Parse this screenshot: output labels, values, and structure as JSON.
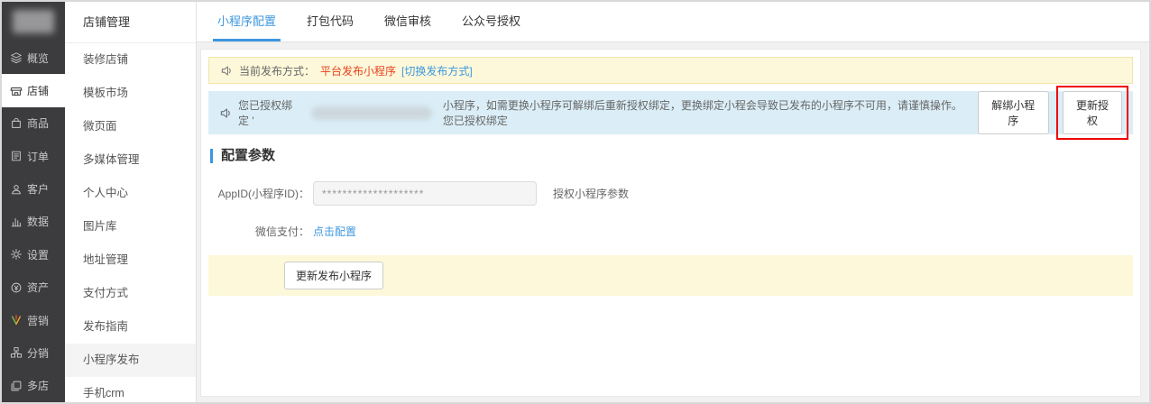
{
  "primary_nav": [
    {
      "label": "概览",
      "icon": "overview-icon"
    },
    {
      "label": "店铺",
      "icon": "store-icon"
    },
    {
      "label": "商品",
      "icon": "goods-icon"
    },
    {
      "label": "订单",
      "icon": "orders-icon"
    },
    {
      "label": "客户",
      "icon": "customers-icon"
    },
    {
      "label": "数据",
      "icon": "data-icon"
    },
    {
      "label": "设置",
      "icon": "settings-icon"
    },
    {
      "label": "资产",
      "icon": "assets-icon"
    },
    {
      "label": "营销",
      "icon": "marketing-icon"
    },
    {
      "label": "分销",
      "icon": "distribution-icon"
    },
    {
      "label": "多店",
      "icon": "multistore-icon"
    }
  ],
  "secondary_nav": {
    "header": "店铺管理",
    "items": [
      {
        "label": "装修店铺"
      },
      {
        "label": "模板市场"
      },
      {
        "label": "微页面"
      },
      {
        "label": "多媒体管理"
      },
      {
        "label": "个人中心"
      },
      {
        "label": "图片库"
      },
      {
        "label": "地址管理"
      },
      {
        "label": "支付方式"
      },
      {
        "label": "发布指南"
      },
      {
        "label": "小程序发布"
      },
      {
        "label": "手机crm"
      }
    ],
    "active_item": "小程序发布"
  },
  "tabs": [
    {
      "label": "小程序配置"
    },
    {
      "label": "打包代码"
    },
    {
      "label": "微信审核"
    },
    {
      "label": "公众号授权"
    }
  ],
  "active_tab": "小程序配置",
  "notices": {
    "publish_mode": {
      "prefix": "当前发布方式：",
      "mode": "平台发布小程序",
      "switch_link": "[切换发布方式]"
    },
    "binding": {
      "text_before": "您已授权绑定 '",
      "text_after": "小程序，如需更换小程序可解绑后重新授权绑定，更换绑定小程会导致已发布的小程序不可用，请谨慎操作。您已授权绑定",
      "unbind_button": "解绑小程序",
      "update_button": "更新授权"
    }
  },
  "config_section": {
    "title": "配置参数",
    "appid_label": "AppID(小程序ID)：",
    "appid_value": "********************",
    "appid_hint": "授权小程序参数",
    "wechat_pay_label": "微信支付：",
    "wechat_pay_link": "点击配置",
    "publish_button": "更新发布小程序"
  },
  "colors": {
    "accent_blue": "#3e97df",
    "sidebar_dark": "#3c3c3e",
    "notice_yellow": "#fdf8d9",
    "notice_blue": "#dbeef7",
    "alert_red": "#e6421f",
    "annotation_red": "#f00000"
  }
}
